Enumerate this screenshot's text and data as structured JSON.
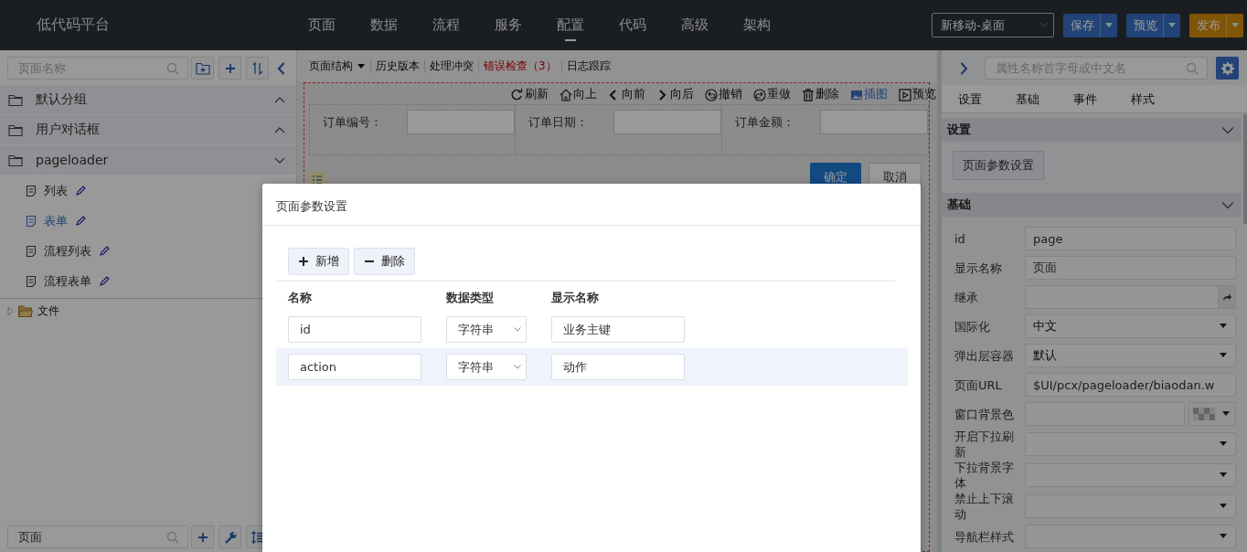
{
  "app": {
    "title": "低代码平台"
  },
  "nav": [
    {
      "label": "页面",
      "selected": false
    },
    {
      "label": "数据",
      "selected": false
    },
    {
      "label": "流程",
      "selected": false
    },
    {
      "label": "服务",
      "selected": false
    },
    {
      "label": "配置",
      "selected": true
    },
    {
      "label": "代码",
      "selected": false
    },
    {
      "label": "高级",
      "selected": false
    },
    {
      "label": "架构",
      "selected": false
    }
  ],
  "device_select": {
    "value": "新移动-桌面"
  },
  "header_buttons": [
    {
      "label": "保存",
      "kind": "primary"
    },
    {
      "label": "预览",
      "kind": "primary"
    },
    {
      "label": "发布",
      "kind": "warning"
    }
  ],
  "left_panel": {
    "search": {
      "placeholder": "页面名称"
    },
    "groups": [
      {
        "label": "默认分组",
        "expanded": false
      },
      {
        "label": "用户对话框",
        "expanded": false
      },
      {
        "label": "pageloader",
        "expanded": true,
        "children": [
          {
            "label": "列表",
            "selected": false
          },
          {
            "label": "表单",
            "selected": true
          },
          {
            "label": "流程列表",
            "selected": false
          },
          {
            "label": "流程表单",
            "selected": false
          }
        ]
      }
    ],
    "tree": [
      {
        "label": "文件",
        "expanded": false
      }
    ],
    "bottom_search": {
      "value": "页面"
    }
  },
  "editor_tabs": [
    {
      "label": "页面结构",
      "kind": "dropdown"
    },
    {
      "label": "历史版本",
      "kind": "plain"
    },
    {
      "label": "处理冲突",
      "kind": "plain"
    },
    {
      "label": "错误检查（3）",
      "kind": "error"
    },
    {
      "label": "日志跟踪",
      "kind": "plain"
    }
  ],
  "design_toolbar": [
    {
      "label": "刷新",
      "kind": "refresh",
      "active": false
    },
    {
      "label": "向上",
      "kind": "up",
      "active": false
    },
    {
      "label": "向前",
      "kind": "back",
      "active": false
    },
    {
      "label": "向后",
      "kind": "forward",
      "active": false
    },
    {
      "label": "撤销",
      "kind": "undo",
      "active": false
    },
    {
      "label": "重做",
      "kind": "redo",
      "active": false
    },
    {
      "label": "删除",
      "kind": "delete",
      "active": false
    },
    {
      "label": "插图",
      "kind": "image",
      "active": true
    },
    {
      "label": "预览",
      "kind": "preview",
      "active": false
    }
  ],
  "form": {
    "fields": [
      {
        "label": "订单编号："
      },
      {
        "label": "订单日期："
      },
      {
        "label": "订单金额："
      }
    ],
    "buttons": [
      {
        "label": "确定",
        "kind": "primary"
      },
      {
        "label": "取消",
        "kind": "default"
      }
    ]
  },
  "right_panel": {
    "search": {
      "placeholder": "属性名称首字母或中文名"
    },
    "tabs": [
      {
        "label": "设置"
      },
      {
        "label": "基础"
      },
      {
        "label": "事件"
      },
      {
        "label": "样式"
      }
    ],
    "settings_section": {
      "title": "设置",
      "expanded": true,
      "button": "页面参数设置"
    },
    "basic_section": {
      "title": "基础",
      "expanded": true,
      "properties": [
        {
          "label": "id",
          "kind": "text",
          "value": "page"
        },
        {
          "label": "显示名称",
          "kind": "text",
          "value": "页面"
        },
        {
          "label": "继承",
          "kind": "link"
        },
        {
          "label": "国际化",
          "kind": "select",
          "value": "中文"
        },
        {
          "label": "弹出层容器",
          "kind": "select",
          "value": "默认"
        },
        {
          "label": "页面URL",
          "kind": "text",
          "value": "$UI/pcx/pageloader/biaodan.w"
        },
        {
          "label": "窗口背景色",
          "kind": "color"
        },
        {
          "label": "开启下拉刷新",
          "kind": "select"
        },
        {
          "label": "下拉背景字体",
          "kind": "select"
        },
        {
          "label": "禁止上下滚动",
          "kind": "select"
        },
        {
          "label": "导航栏样式",
          "kind": "select"
        }
      ]
    }
  },
  "dialog": {
    "title": "页面参数设置",
    "buttons": [
      {
        "label": "新增",
        "kind": "add"
      },
      {
        "label": "删除",
        "kind": "remove"
      }
    ],
    "columns": [
      "名称",
      "数据类型",
      "显示名称"
    ],
    "rows": [
      {
        "name": "id",
        "type": "字符串",
        "display": "业务主键",
        "selected": false
      },
      {
        "name": "action",
        "type": "字符串",
        "display": "动作",
        "selected": true
      }
    ]
  }
}
